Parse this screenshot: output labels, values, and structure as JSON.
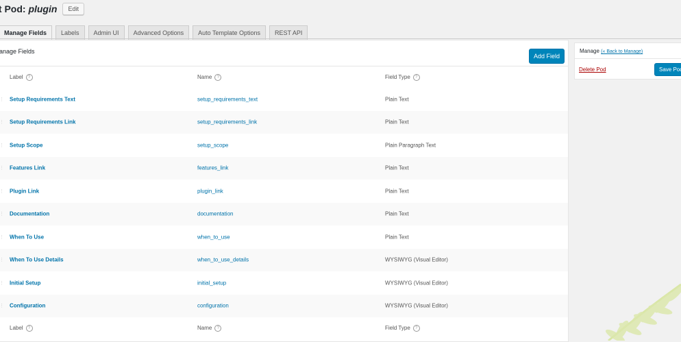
{
  "header": {
    "title_prefix": "it Pod: ",
    "title_pod": "plugin",
    "edit_label": "Edit"
  },
  "tabs": [
    {
      "label": "Manage Fields",
      "active": true
    },
    {
      "label": "Labels"
    },
    {
      "label": "Admin UI"
    },
    {
      "label": "Advanced Options"
    },
    {
      "label": "Auto Template Options"
    },
    {
      "label": "REST API"
    }
  ],
  "main": {
    "title": "anage Fields",
    "add_field_label": "Add Field",
    "columns": {
      "label": "Label",
      "name": "Name",
      "type": "Field Type"
    },
    "rows": [
      {
        "label": "Setup Requirements Text",
        "name": "setup_requirements_text",
        "type": "Plain Text"
      },
      {
        "label": "Setup Requirements Link",
        "name": "setup_requirements_link",
        "type": "Plain Text"
      },
      {
        "label": "Setup Scope",
        "name": "setup_scope",
        "type": "Plain Paragraph Text"
      },
      {
        "label": "Features Link",
        "name": "features_link",
        "type": "Plain Text"
      },
      {
        "label": "Plugin Link",
        "name": "plugin_link",
        "type": "Plain Text"
      },
      {
        "label": "Documentation",
        "name": "documentation",
        "type": "Plain Text"
      },
      {
        "label": "When To Use",
        "name": "when_to_use",
        "type": "Plain Text"
      },
      {
        "label": "When To Use Details",
        "name": "when_to_use_details",
        "type": "WYSIWYG (Visual Editor)"
      },
      {
        "label": "Initial Setup",
        "name": "initial_setup",
        "type": "WYSIWYG (Visual Editor)"
      },
      {
        "label": "Configuration",
        "name": "configuration",
        "type": "WYSIWYG (Visual Editor)"
      }
    ]
  },
  "sidebar": {
    "title": "Manage",
    "back_link": "(« Back to Manage)",
    "delete_label": "Delete Pod",
    "save_label": "Save Pod"
  },
  "colors": {
    "accent": "#0085ba",
    "link": "#0073aa",
    "danger": "#aa0000"
  }
}
